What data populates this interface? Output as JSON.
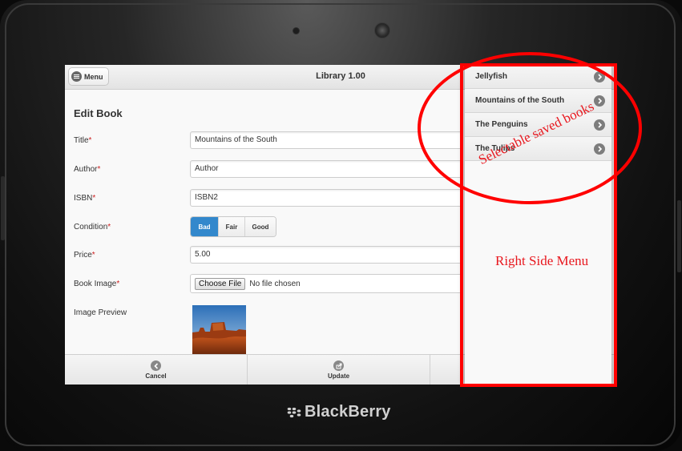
{
  "device": {
    "brand": "BlackBerry"
  },
  "header": {
    "menu_label": "Menu",
    "title": "Library 1.00"
  },
  "form": {
    "section_title": "Edit Book",
    "title_label": "Title",
    "title_value": "Mountains of the South",
    "author_label": "Author",
    "author_placeholder": "Author",
    "isbn_label": "ISBN",
    "isbn_value": "ISBN2",
    "condition_label": "Condition",
    "condition_options": [
      "Bad",
      "Fair",
      "Good"
    ],
    "condition_selected": "Bad",
    "price_label": "Price",
    "price_value": "5.00",
    "image_label": "Book Image",
    "choose_file_label": "Choose File",
    "no_file_text": "No file chosen",
    "preview_label": "Image Preview",
    "required_mark": "*"
  },
  "footer": {
    "cancel_label": "Cancel",
    "update_label": "Update"
  },
  "right_menu": {
    "books": [
      "Jellyfish",
      "Mountains of the South",
      "The Penguins",
      "The Tulips"
    ]
  },
  "annotations": {
    "saved_books": "Selectable saved books",
    "right_side_menu": "Right Side Menu",
    "color": "#ff0000"
  },
  "colors": {
    "accent": "#3388cc",
    "required": "#cc1f1f"
  }
}
